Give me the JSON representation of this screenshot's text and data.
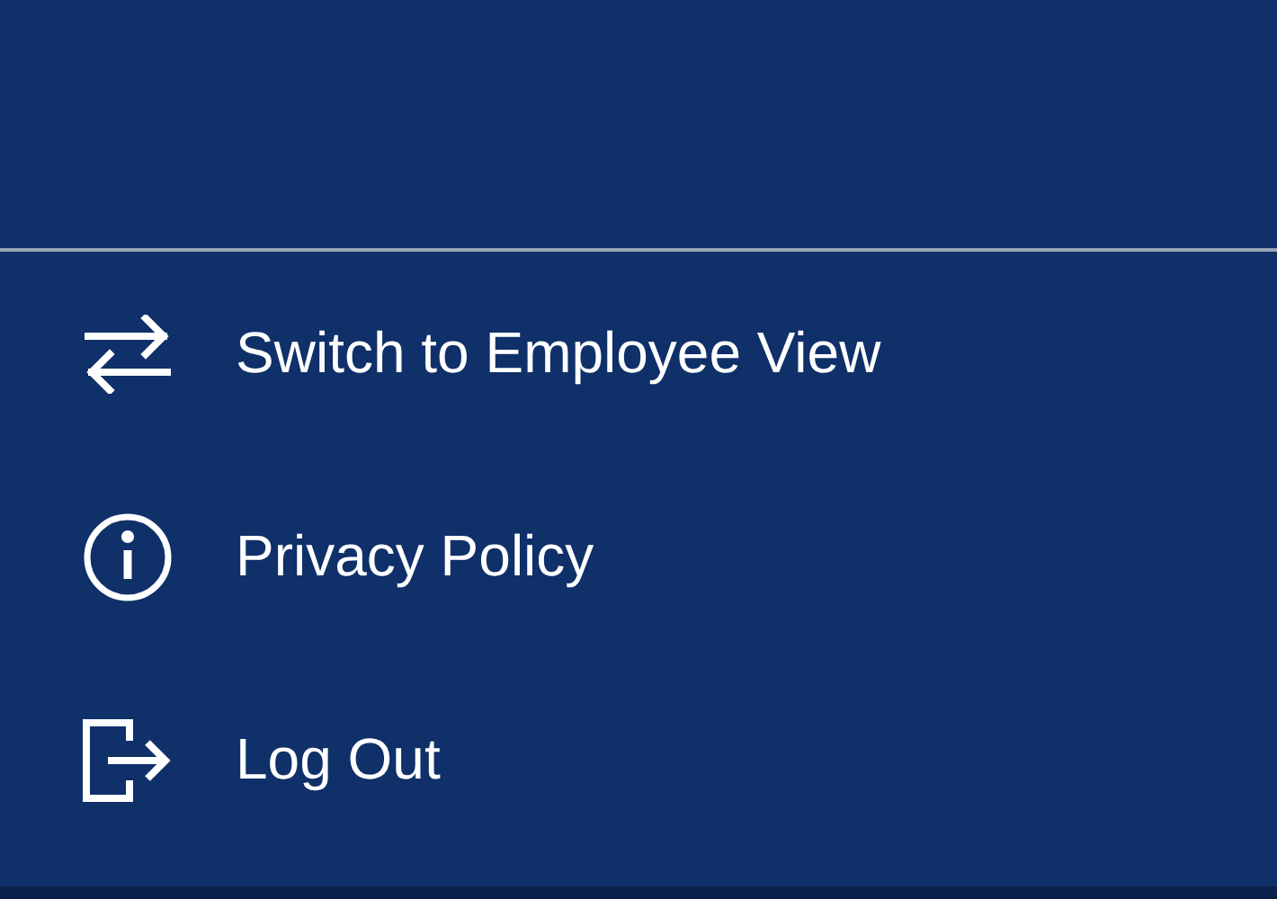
{
  "menu": {
    "items": [
      {
        "kind": "switch",
        "label": "Switch to Employee View"
      },
      {
        "kind": "info",
        "label": "Privacy Policy"
      },
      {
        "kind": "logout",
        "label": "Log Out"
      }
    ]
  }
}
